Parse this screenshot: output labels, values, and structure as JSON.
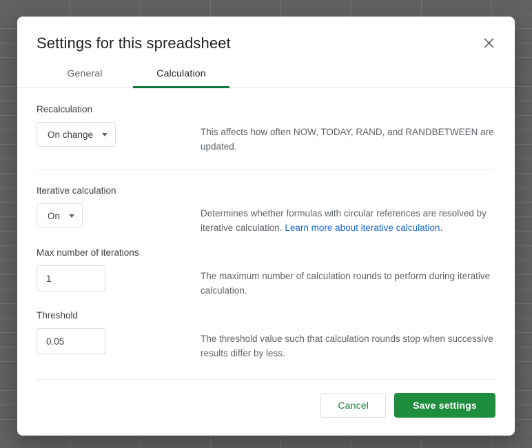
{
  "dialog": {
    "title": "Settings for this spreadsheet",
    "close_icon": "close-icon"
  },
  "tabs": [
    {
      "label": "General",
      "active": false
    },
    {
      "label": "Calculation",
      "active": true
    }
  ],
  "sections": {
    "recalculation": {
      "label": "Recalculation",
      "select_value": "On change",
      "description": "This affects how often NOW, TODAY, RAND, and RANDBETWEEN are updated."
    },
    "iterative_calculation": {
      "label": "Iterative calculation",
      "select_value": "On",
      "description_text": "Determines whether formulas with circular references are resolved by iterative calculation. ",
      "description_link": "Learn more about iterative calculation."
    },
    "max_iterations": {
      "label": "Max number of iterations",
      "value": "1",
      "placeholder": "",
      "description": "The maximum number of calculation rounds to perform during iterative calculation."
    },
    "threshold": {
      "label": "Threshold",
      "value": "0.05",
      "placeholder": "",
      "description": "The threshold value such that calculation rounds stop when successive results differ by less."
    }
  },
  "footer": {
    "cancel_label": "Cancel",
    "save_label": "Save settings"
  },
  "colors": {
    "accent_green": "#1e8e3e",
    "tab_underline": "#0f7b3f",
    "link_blue": "#1967d2",
    "scrim": "#616161"
  }
}
